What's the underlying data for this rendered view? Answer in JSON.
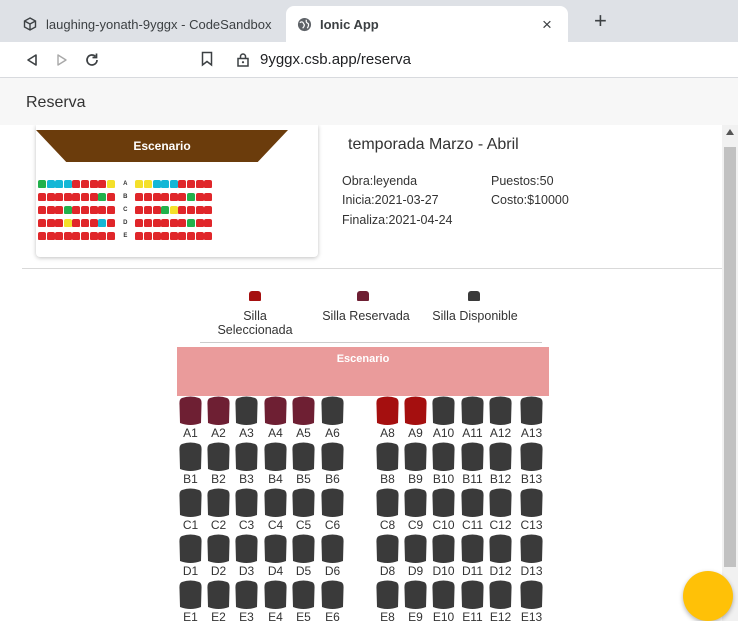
{
  "browser": {
    "tabs": [
      {
        "title": "laughing-yonath-9yggx - CodeSandbox",
        "icon": "codesandbox-icon",
        "active": false
      },
      {
        "title": "Ionic App",
        "icon": "globe-icon",
        "active": true
      }
    ],
    "close_label": "×",
    "new_tab_label": "+",
    "url": "9yggx.csb.app/reserva"
  },
  "header": {
    "title": "Reserva"
  },
  "card": {
    "stage_label": "Escenario",
    "season": "temporada Marzo - Abril",
    "obra": "Obra:leyenda",
    "inicia": "Inicia:2021-03-27",
    "finaliza": "Finaliza:2021-04-24",
    "puestos": "Puestos:50",
    "costo": "Costo:$10000",
    "row_letters": [
      "A",
      "B",
      "C",
      "D",
      "E"
    ]
  },
  "legend": {
    "selected": "Silla\nSeleccionada",
    "selected_line1": "Silla",
    "selected_line2": "Seleccionada",
    "reserved": "Silla Reservada",
    "available": "Silla Disponible"
  },
  "stage": {
    "label": "Escenario"
  },
  "colors": {
    "selected": "#a50f0f",
    "reserved": "#6e1f33",
    "available": "#3a3a3a",
    "stage": "#ea9b9b",
    "fab": "#ffc107"
  },
  "seats": {
    "rows": [
      {
        "left": [
          "A1",
          "A2",
          "A3",
          "A4",
          "A5",
          "A6"
        ],
        "right": [
          "A8",
          "A9",
          "A10",
          "A11",
          "A12",
          "A13"
        ],
        "left_state": [
          "reserved",
          "reserved",
          "available",
          "reserved",
          "reserved",
          "available"
        ],
        "right_state": [
          "selected",
          "selected",
          "available",
          "available",
          "available",
          "available"
        ]
      },
      {
        "left": [
          "B1",
          "B2",
          "B3",
          "B4",
          "B5",
          "B6"
        ],
        "right": [
          "B8",
          "B9",
          "B10",
          "B11",
          "B12",
          "B13"
        ],
        "left_state": [
          "available",
          "available",
          "available",
          "available",
          "available",
          "available"
        ],
        "right_state": [
          "available",
          "available",
          "available",
          "available",
          "available",
          "available"
        ]
      },
      {
        "left": [
          "C1",
          "C2",
          "C3",
          "C4",
          "C5",
          "C6"
        ],
        "right": [
          "C8",
          "C9",
          "C10",
          "C11",
          "C12",
          "C13"
        ],
        "left_state": [
          "available",
          "available",
          "available",
          "available",
          "available",
          "available"
        ],
        "right_state": [
          "available",
          "available",
          "available",
          "available",
          "available",
          "available"
        ]
      },
      {
        "left": [
          "D1",
          "D2",
          "D3",
          "D4",
          "D5",
          "D6"
        ],
        "right": [
          "D8",
          "D9",
          "D10",
          "D11",
          "D12",
          "D13"
        ],
        "left_state": [
          "available",
          "available",
          "available",
          "available",
          "available",
          "available"
        ],
        "right_state": [
          "available",
          "available",
          "available",
          "available",
          "available",
          "available"
        ]
      },
      {
        "left": [
          "E1",
          "E2",
          "E3",
          "E4",
          "E5",
          "E6"
        ],
        "right": [
          "E8",
          "E9",
          "E10",
          "E11",
          "E12",
          "E13"
        ],
        "left_state": [
          "available",
          "available",
          "available",
          "available",
          "available",
          "available"
        ],
        "right_state": [
          "available",
          "available",
          "available",
          "available",
          "available",
          "available"
        ]
      }
    ]
  }
}
